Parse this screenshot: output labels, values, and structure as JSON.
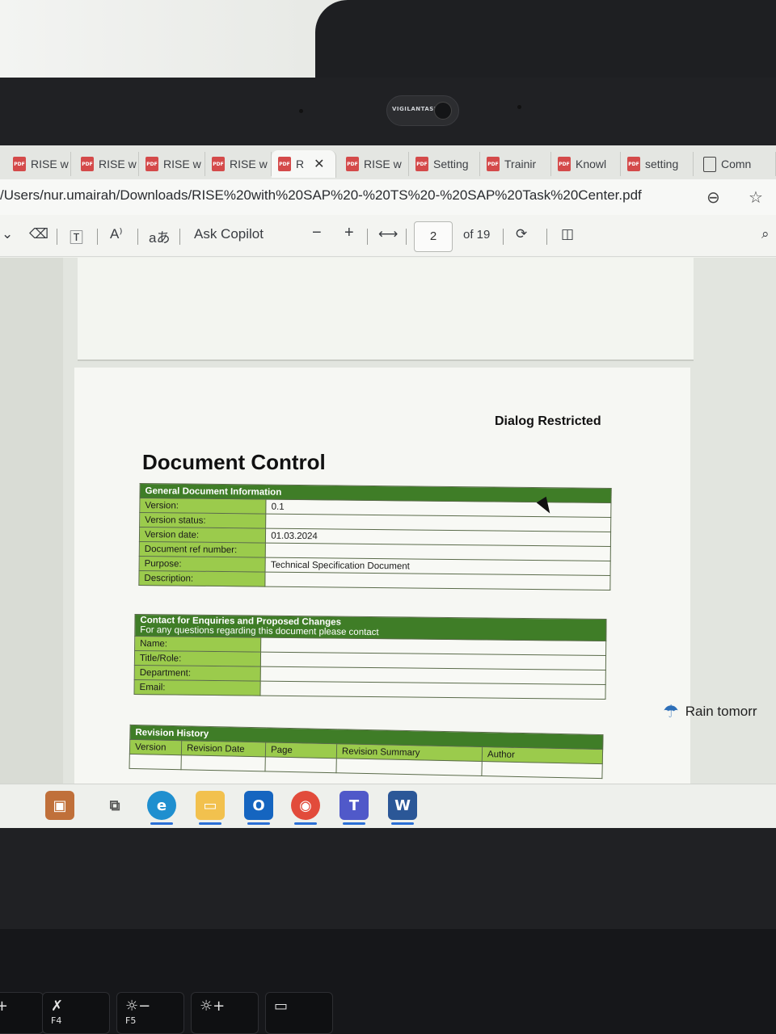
{
  "camera": {
    "brand": "VIGILANTASIA"
  },
  "tabs": [
    {
      "label": "RISE w",
      "icon": "pdf-icon"
    },
    {
      "label": "RISE w",
      "icon": "pdf-icon"
    },
    {
      "label": "RISE w",
      "icon": "pdf-icon"
    },
    {
      "label": "RISE w",
      "icon": "pdf-icon"
    },
    {
      "label": "R",
      "icon": "pdf-icon",
      "active": true
    },
    {
      "label": "RISE w",
      "icon": "pdf-icon"
    },
    {
      "label": "Setting",
      "icon": "pdf-icon"
    },
    {
      "label": "Trainir",
      "icon": "pdf-icon"
    },
    {
      "label": "Knowl",
      "icon": "pdf-icon"
    },
    {
      "label": "setting",
      "icon": "pdf-icon"
    },
    {
      "label": "Comn",
      "icon": "document-icon"
    }
  ],
  "address": {
    "url": "/Users/nur.umairah/Downloads/RISE%20with%20SAP%20-%20TS%20-%20SAP%20Task%20Center.pdf"
  },
  "pdf_toolbar": {
    "ask_copilot": "Ask Copilot",
    "page_current": "2",
    "page_total": "of 19",
    "zoom_out": "−",
    "zoom_in": "+"
  },
  "document": {
    "classification": "Dialog Restricted",
    "title": "Document Control",
    "general_info": {
      "header": "General Document Information",
      "rows": [
        {
          "label": "Version:",
          "value": "0.1"
        },
        {
          "label": "Version status:",
          "value": ""
        },
        {
          "label": "Version date:",
          "value": "01.03.2024"
        },
        {
          "label": "Document ref number:",
          "value": ""
        },
        {
          "label": "Purpose:",
          "value": "Technical Specification Document"
        },
        {
          "label": "Description:",
          "value": ""
        }
      ]
    },
    "contact": {
      "header": "Contact for Enquiries and Proposed Changes",
      "subheader": "For any questions regarding this document please contact",
      "rows": [
        {
          "label": "Name:",
          "value": ""
        },
        {
          "label": "Title/Role:",
          "value": ""
        },
        {
          "label": "Department:",
          "value": ""
        },
        {
          "label": "Email:",
          "value": ""
        }
      ]
    },
    "revision_history": {
      "header": "Revision History",
      "columns": [
        "Version",
        "Revision Date",
        "Page",
        "Revision Summary",
        "Author"
      ]
    }
  },
  "taskbar": {
    "weather": "Rain tomorr"
  },
  "keyboard": {
    "f4_label": "F4",
    "f5_label": "F5"
  }
}
